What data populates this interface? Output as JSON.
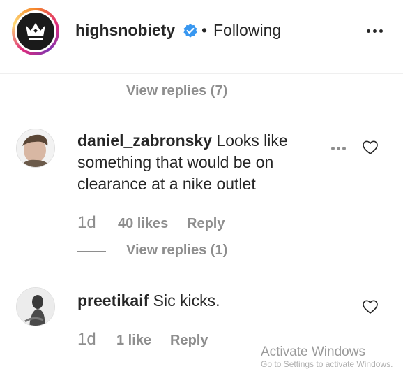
{
  "header": {
    "username": "highsnobiety",
    "separator": "•",
    "follow_status": "Following"
  },
  "thread_top": {
    "view_replies": "View replies (7)"
  },
  "comments": [
    {
      "username": "daniel_zabronsky",
      "text": "Looks like something that would be on clearance at a nike outlet",
      "time": "1d",
      "likes": "40 likes",
      "reply": "Reply",
      "view_replies": "View replies (1)"
    },
    {
      "username": "preetikaif",
      "text": "Sic kicks.",
      "time": "1d",
      "likes": "1 like",
      "reply": "Reply"
    }
  ],
  "watermark": {
    "line1": "Activate Windows",
    "line2": "Go to Settings to activate Windows."
  },
  "colors": {
    "text": "#262626",
    "muted": "#8e8e8e",
    "verified": "#3897f0"
  }
}
